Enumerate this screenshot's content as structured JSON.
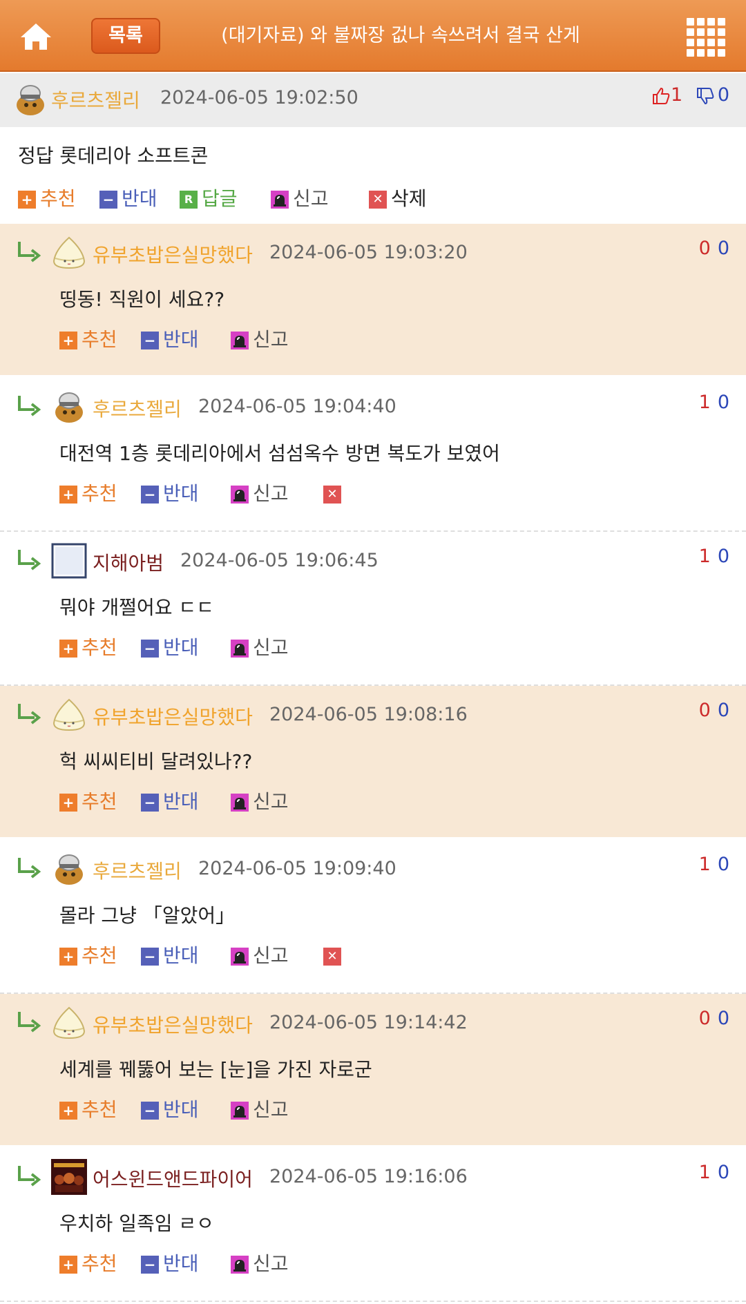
{
  "header": {
    "home_icon": "home-icon",
    "list_label": "목록",
    "title": "(대기자료) 와 불짜장 겂나 속쓰려서 결국 산게",
    "menu_icon": "grid-menu-icon",
    "accent_color": "#e47a2d"
  },
  "post": {
    "author": "후르츠젤리",
    "date": "2024-06-05 19:02:50",
    "likes": "1",
    "dislikes": "0",
    "content": "정답 롯데리아 소프트콘",
    "actions": {
      "recommend": "추천",
      "oppose": "반대",
      "reply": "답글",
      "report": "신고",
      "delete": "삭제"
    }
  },
  "comment_actions": {
    "recommend": "추천",
    "oppose": "반대",
    "report": "신고"
  },
  "comments": [
    {
      "author": "유부초밥은실망했다",
      "date": "2024-06-05 19:03:20",
      "up": "0",
      "down": "0",
      "text": "띵동! 직원이 세요??",
      "avatar": "rice-ball",
      "nick_color": "#f0a32c",
      "highlight": true,
      "deletable": false
    },
    {
      "author": "후르츠젤리",
      "date": "2024-06-05 19:04:40",
      "up": "1",
      "down": "0",
      "text": "대전역 1층 롯데리아에서 섬섬옥수 방면 복도가 보였어",
      "avatar": "helmet",
      "nick_color": "#e9a93c",
      "highlight": false,
      "deletable": true
    },
    {
      "author": "지해아범",
      "date": "2024-06-05 19:06:45",
      "up": "1",
      "down": "0",
      "text": "뭐야 개쩔어요 ㄷㄷ",
      "avatar": "blank",
      "nick_color": "#7a1f1f",
      "highlight": false,
      "deletable": false
    },
    {
      "author": "유부초밥은실망했다",
      "date": "2024-06-05 19:08:16",
      "up": "0",
      "down": "0",
      "text": "헉 씨씨티비 달려있나??",
      "avatar": "rice-ball",
      "nick_color": "#f0a32c",
      "highlight": true,
      "deletable": false
    },
    {
      "author": "후르츠젤리",
      "date": "2024-06-05 19:09:40",
      "up": "1",
      "down": "0",
      "text": "몰라 그냥 「알았어」",
      "avatar": "helmet",
      "nick_color": "#e9a93c",
      "highlight": false,
      "deletable": true
    },
    {
      "author": "유부초밥은실망했다",
      "date": "2024-06-05 19:14:42",
      "up": "0",
      "down": "0",
      "text": "세계를 꿰뚫어 보는 [눈]을 가진 자로군",
      "avatar": "rice-ball",
      "nick_color": "#f0a32c",
      "highlight": true,
      "deletable": false
    },
    {
      "author": "어스윈드앤드파이어",
      "date": "2024-06-05 19:16:06",
      "up": "1",
      "down": "0",
      "text": "우치하 일족임 ㄹㅇ",
      "avatar": "album",
      "nick_color": "#7a1f1f",
      "highlight": false,
      "deletable": false
    }
  ]
}
